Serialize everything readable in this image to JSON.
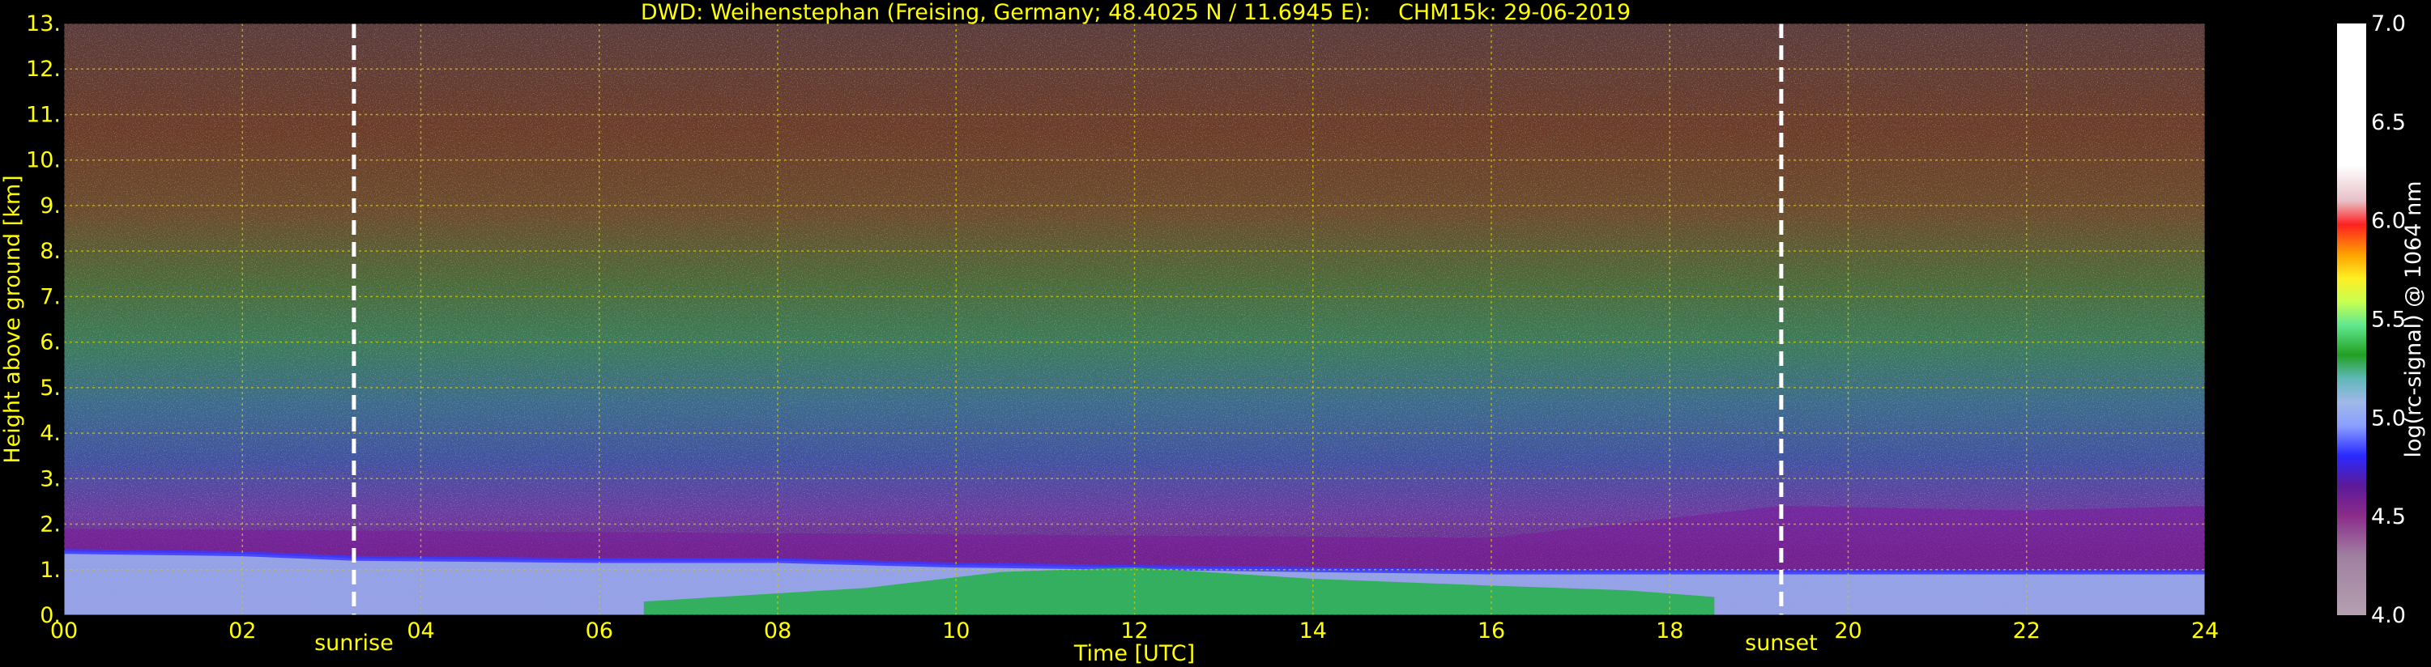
{
  "chart_data": {
    "type": "heatmap",
    "title": "DWD: Weihenstephan (Freising, Germany; 48.4025 N / 11.6945 E):    CHM15k: 29-06-2019",
    "xlabel": "Time [UTC]",
    "ylabel": "Height above ground [km]",
    "xlim": [
      0,
      24
    ],
    "ylim": [
      0,
      13
    ],
    "x_ticks": [
      "00",
      "02",
      "04",
      "06",
      "08",
      "10",
      "12",
      "14",
      "16",
      "18",
      "20",
      "22",
      "24"
    ],
    "y_ticks": [
      "0.",
      "1.",
      "2.",
      "3.",
      "4.",
      "5.",
      "6.",
      "7.",
      "8.",
      "9.",
      "10.",
      "11.",
      "12.",
      "13."
    ],
    "grid": true,
    "colorbar": {
      "label": "log(rc-signal) @ 1064 nm",
      "range": [
        4.0,
        7.0
      ],
      "ticks": [
        "4.0",
        "4.5",
        "5.0",
        "5.5",
        "6.0",
        "6.5",
        "7.0"
      ]
    },
    "annotations": [
      {
        "label": "sunrise",
        "x": 3.25
      },
      {
        "label": "sunset",
        "x": 19.25
      }
    ],
    "layers": {
      "boundary_layer_top_km": [
        [
          0.0,
          1.4
        ],
        [
          2.0,
          1.35
        ],
        [
          3.25,
          1.25
        ],
        [
          6.0,
          1.2
        ],
        [
          8.0,
          1.2
        ],
        [
          10.0,
          1.1
        ],
        [
          12.0,
          1.05
        ],
        [
          14.0,
          1.0
        ],
        [
          16.0,
          0.95
        ],
        [
          18.0,
          0.95
        ],
        [
          19.25,
          0.95
        ],
        [
          24.0,
          0.95
        ]
      ],
      "residual_layer_top_km": [
        [
          0.0,
          1.9
        ],
        [
          8.0,
          1.8
        ],
        [
          16.0,
          1.7
        ],
        [
          19.25,
          2.4
        ],
        [
          22.0,
          2.3
        ],
        [
          24.0,
          2.4
        ]
      ],
      "convective_green_top_km": [
        [
          6.5,
          0.3
        ],
        [
          9.0,
          0.6
        ],
        [
          10.5,
          0.95
        ],
        [
          12.0,
          1.05
        ],
        [
          14.0,
          0.8
        ],
        [
          16.0,
          0.65
        ],
        [
          17.5,
          0.55
        ],
        [
          18.5,
          0.4
        ]
      ]
    },
    "colors": {
      "background": "#000000",
      "text": "#ffff00",
      "grid": "#c8c800",
      "annotation_line": "#ffffff",
      "tick_label_colorbar": "#ffffff"
    }
  }
}
